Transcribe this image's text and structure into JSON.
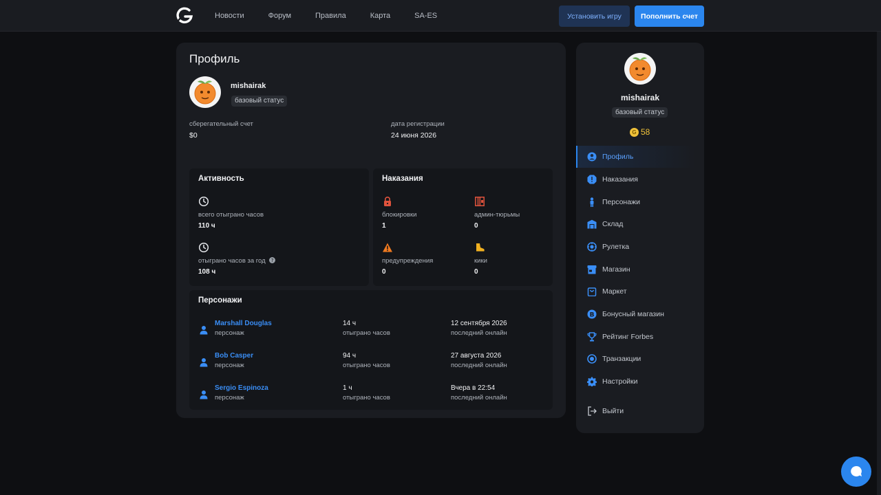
{
  "nav": {
    "items": [
      "Новости",
      "Форум",
      "Правила",
      "Карта",
      "SA-ES"
    ],
    "install_label": "Установить игру",
    "topup_label": "Пополнить счет"
  },
  "profile": {
    "title": "Профиль",
    "username": "mishairak",
    "status": "базовый статус",
    "savings_label": "сберегательный счет",
    "savings_value": "$0",
    "reg_label": "дата регистрации",
    "reg_value": "24 июня 2026"
  },
  "activity": {
    "title": "Активность",
    "total_label": "всего отыграно часов",
    "total_value": "110 ч",
    "year_label": "отыграно часов за год",
    "year_value": "108 ч"
  },
  "punishments": {
    "title": "Наказания",
    "items": [
      {
        "label": "блокировки",
        "value": "1",
        "icon": "lock-icon"
      },
      {
        "label": "админ-тюрьмы",
        "value": "0",
        "icon": "jail-icon"
      },
      {
        "label": "предупреждения",
        "value": "0",
        "icon": "warning-icon"
      },
      {
        "label": "кики",
        "value": "0",
        "icon": "boot-icon"
      }
    ]
  },
  "characters": {
    "title": "Персонажи",
    "rows": [
      {
        "name": "Marshall Douglas",
        "role": "персонаж",
        "hours": "14 ч",
        "hours_label": "отыграно часов",
        "last": "12 сентября 2026",
        "last_label": "последний онлайн"
      },
      {
        "name": "Bob Casper",
        "role": "персонаж",
        "hours": "94 ч",
        "hours_label": "отыграно часов",
        "last": "27 августа 2026",
        "last_label": "последний онлайн"
      },
      {
        "name": "Sergio Espinoza",
        "role": "персонаж",
        "hours": "1 ч",
        "hours_label": "отыграно часов",
        "last": "Вчера в 22:54",
        "last_label": "последний онлайн"
      }
    ]
  },
  "sidebar": {
    "username": "mishairak",
    "status": "базовый статус",
    "coin_symbol": "G",
    "coins": "58",
    "items": [
      {
        "label": "Профиль",
        "icon": "user-circle-icon",
        "active": true
      },
      {
        "label": "Наказания",
        "icon": "alert-octagon-icon"
      },
      {
        "label": "Персонажи",
        "icon": "person-icon"
      },
      {
        "label": "Склад",
        "icon": "warehouse-icon"
      },
      {
        "label": "Рулетка",
        "icon": "roulette-icon"
      },
      {
        "label": "Магазин",
        "icon": "store-icon"
      },
      {
        "label": "Маркет",
        "icon": "shopping-bag-icon"
      },
      {
        "label": "Бонусный магазин",
        "icon": "bonus-coin-icon"
      },
      {
        "label": "Рейтинг Forbes",
        "icon": "trophy-icon"
      },
      {
        "label": "Транзакции",
        "icon": "transactions-icon"
      },
      {
        "label": "Настройки",
        "icon": "gear-icon"
      }
    ],
    "logout_label": "Выйти"
  },
  "colors": {
    "accent": "#2b86ee",
    "danger": "#e0533d",
    "warning": "#f0a020",
    "coin": "#f0c23a"
  }
}
